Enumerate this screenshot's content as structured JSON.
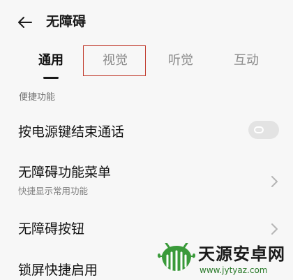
{
  "header": {
    "title": "无障碍",
    "back_icon": "arrow-left-icon"
  },
  "tabs": [
    {
      "label": "通用",
      "active": true
    },
    {
      "label": "视觉",
      "active": false
    },
    {
      "label": "听觉",
      "active": false
    },
    {
      "label": "互动",
      "active": false
    }
  ],
  "section": {
    "label": "便捷功能"
  },
  "rows": [
    {
      "title": "按电源键结束通话",
      "subtitle": "",
      "control": "toggle",
      "toggle_on": false
    },
    {
      "title": "无障碍功能菜单",
      "subtitle": "快捷显示常用功能",
      "control": "chevron"
    },
    {
      "title": "无障碍按钮",
      "subtitle": "",
      "control": "chevron"
    },
    {
      "title": "锁屏快捷启用",
      "subtitle": "",
      "control": "none"
    }
  ],
  "watermark": {
    "text": "天源安卓网",
    "url": "www.jytyaz.com"
  },
  "colors": {
    "background": "#f7f7f7",
    "highlight_border": "#c0392b",
    "inactive_tab": "#8a8a8a",
    "toggle_off": "#e3e3e3"
  }
}
